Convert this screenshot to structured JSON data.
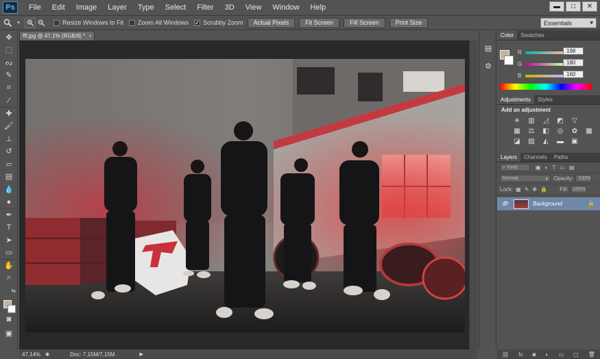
{
  "app": {
    "logo": "Ps"
  },
  "menu": [
    "File",
    "Edit",
    "Image",
    "Layer",
    "Type",
    "Select",
    "Filter",
    "3D",
    "View",
    "Window",
    "Help"
  ],
  "window_controls": {
    "minimize": "▬",
    "maximize": "□",
    "close": "✕"
  },
  "options_bar": {
    "resize_windows": "Resize Windows to Fit",
    "zoom_all": "Zoom All Windows",
    "scrubby_zoom": "Scrubby Zoom",
    "actual_pixels": "Actual Pixels",
    "fit_screen": "Fit Screen",
    "fill_screen": "Fill Screen",
    "print_size": "Print Size",
    "workspace": "Essentials"
  },
  "document": {
    "tab_title": "fff.jpg @ 47,1% (RGB/8) *"
  },
  "status_bar": {
    "zoom": "47,14%",
    "doc_size": "Doc: 7,15M/7,15M"
  },
  "color_panel": {
    "tabs": [
      "Color",
      "Swatches"
    ],
    "r_label": "R",
    "g_label": "G",
    "b_label": "B",
    "r": "198",
    "g": "180",
    "b": "160",
    "foreground_color": "#c6b4a0"
  },
  "adjustments_panel": {
    "tabs": [
      "Adjustments",
      "Styles"
    ],
    "title": "Add an adjustment"
  },
  "layers_panel": {
    "tabs": [
      "Layers",
      "Channels",
      "Paths"
    ],
    "kind": "Kind",
    "blend_mode": "Normal",
    "opacity_label": "Opacity:",
    "opacity_value": "100%",
    "lock_label": "Lock:",
    "fill_label": "Fill:",
    "fill_value": "100%",
    "layer_name": "Background"
  },
  "colors": {
    "accent_layer": "#6f87a8",
    "team_red": "#c8303a"
  }
}
